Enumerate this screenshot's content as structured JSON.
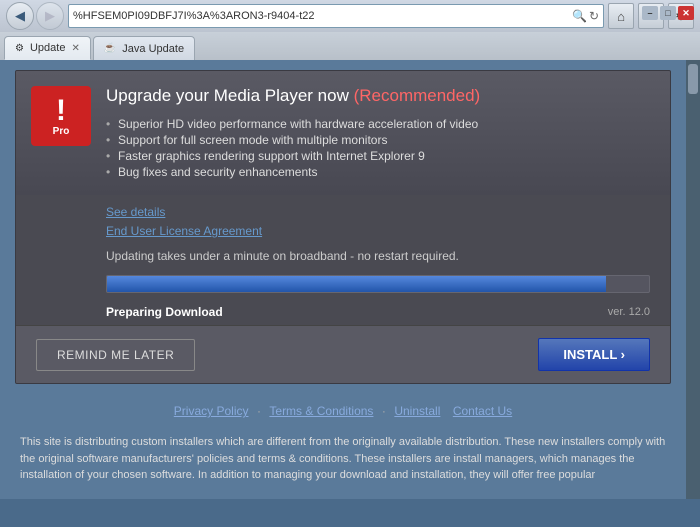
{
  "browser": {
    "address": "%HFSEM0PI09DBFJ7I%3A%3ARON3-r9404-t22",
    "tab1_label": "Update",
    "tab2_label": "Java Update",
    "back_icon": "◀",
    "forward_icon": "▶",
    "refresh_icon": "↻",
    "home_icon": "⌂",
    "star_icon": "★",
    "tools_icon": "⚙"
  },
  "window_controls": {
    "minimize": "–",
    "maximize": "□",
    "close": "✕"
  },
  "popup": {
    "title": "Upgrade your Media Player now",
    "recommended": "(Recommended)",
    "features": [
      "Superior HD video performance with hardware acceleration of video",
      "Support for full screen mode with multiple monitors",
      "Faster graphics rendering support with Internet Explorer 9",
      "Bug fixes and security enhancements"
    ],
    "see_details": "See details",
    "eula": "End User License Agreement",
    "update_note": "Updating takes under a minute on broadband - no restart required.",
    "preparing_download": "Preparing Download",
    "version": "ver. 12.0",
    "pro_label": "Pro",
    "exclaim": "!"
  },
  "buttons": {
    "remind_later": "REMIND ME LATER",
    "install": "INSTALL ›"
  },
  "footer": {
    "privacy": "Privacy Policy",
    "terms": "Terms & Conditions",
    "uninstall": "Uninstall",
    "contact": "Contact Us",
    "separator1": "·",
    "separator2": "·",
    "separator3": " ",
    "body_text": "This site is distributing custom installers which are different from the originally available distribution. These new installers comply with the original software manufacturers' policies and terms & conditions. These installers are install managers, which manages the installation of your chosen software. In addition to managing your download and installation, they will offer free popular"
  }
}
